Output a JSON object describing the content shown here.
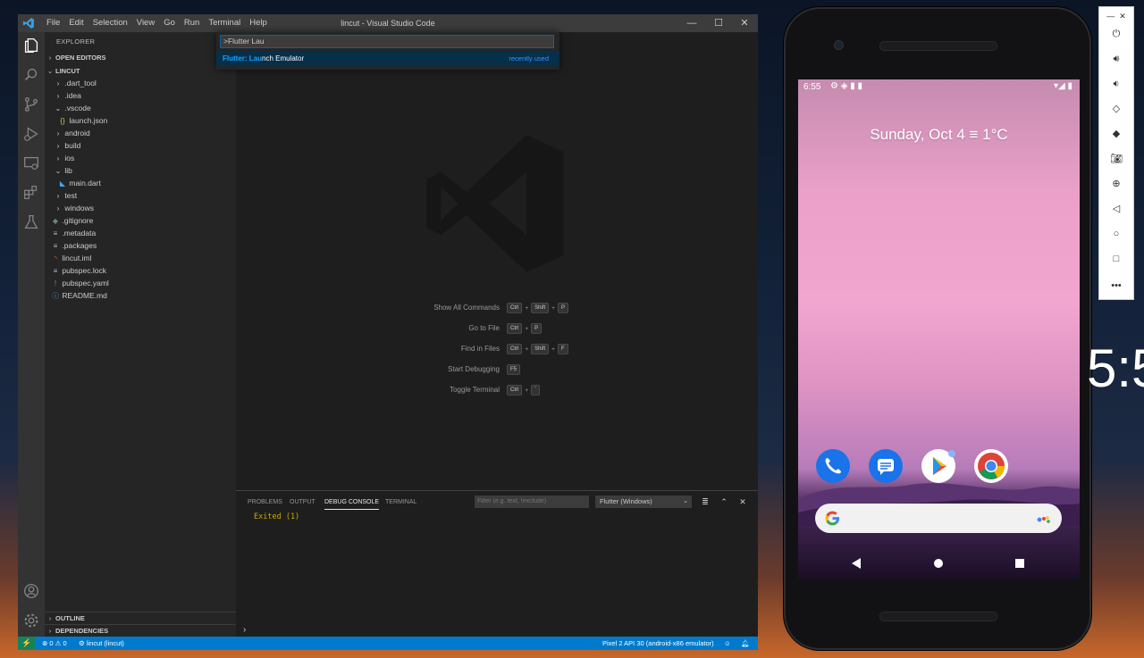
{
  "vscode": {
    "menu": [
      "File",
      "Edit",
      "Selection",
      "View",
      "Go",
      "Run",
      "Terminal",
      "Help"
    ],
    "window_title": "lincut - Visual Studio Code",
    "win_controls": {
      "minimize": "—",
      "maximize": "☐",
      "close": "✕"
    },
    "sidebar": {
      "header": "EXPLORER",
      "open_editors": "OPEN EDITORS",
      "project": "LINCUT",
      "tree": [
        {
          "label": ".dart_tool",
          "icon": "›"
        },
        {
          "label": ".idea",
          "icon": "›"
        },
        {
          "label": ".vscode",
          "icon": "⌄"
        },
        {
          "label": "launch.json",
          "icon": "{}"
        },
        {
          "label": "android",
          "icon": "›"
        },
        {
          "label": "build",
          "icon": "›"
        },
        {
          "label": "ios",
          "icon": "›"
        },
        {
          "label": "lib",
          "icon": "⌄"
        },
        {
          "label": "main.dart",
          "icon": "◣"
        },
        {
          "label": "test",
          "icon": "›"
        },
        {
          "label": "windows",
          "icon": "›"
        },
        {
          "label": ".gitignore",
          "icon": "◆"
        },
        {
          "label": ".metadata",
          "icon": "≡"
        },
        {
          "label": ".packages",
          "icon": "≡"
        },
        {
          "label": "lincut.iml",
          "icon": "◝"
        },
        {
          "label": "pubspec.lock",
          "icon": "≡"
        },
        {
          "label": "pubspec.yaml",
          "icon": "!"
        },
        {
          "label": "README.md",
          "icon": "ⓘ"
        }
      ],
      "outline": "OUTLINE",
      "dependencies": "DEPENDENCIES"
    },
    "quick_open": {
      "input_value": ">Flutter Lau",
      "result_highlight": "Flutter: Lau",
      "result_rest": "nch Emulator",
      "result_hint": "recently used"
    },
    "shortcuts": [
      {
        "label": "Show All Commands",
        "keys": [
          "Ctrl",
          "Shift",
          "P"
        ]
      },
      {
        "label": "Go to File",
        "keys": [
          "Ctrl",
          "P"
        ]
      },
      {
        "label": "Find in Files",
        "keys": [
          "Ctrl",
          "Shift",
          "F"
        ]
      },
      {
        "label": "Start Debugging",
        "keys": [
          "F5"
        ]
      },
      {
        "label": "Toggle Terminal",
        "keys": [
          "Ctrl",
          "`"
        ]
      }
    ],
    "panel": {
      "tabs": [
        "PROBLEMS",
        "OUTPUT",
        "DEBUG CONSOLE",
        "TERMINAL"
      ],
      "filter_placeholder": "Filter (e.g. text, !exclude)",
      "select_value": "Flutter (Windows)",
      "console_output": "Exited (1)",
      "prompt": "›"
    },
    "status": {
      "errors": "0",
      "warnings": "0",
      "branch": "lincut (lincut)",
      "device": "Pixel 2 API 30 (android-x86 emulator)"
    },
    "colors": {
      "accent": "#007acc",
      "remote": "#16825d",
      "highlight": "#18a3ff",
      "warning": "#cca700"
    }
  },
  "emulator": {
    "time": "6:55",
    "date_line": "Sunday, Oct 4 ≡ 1°C",
    "apps": [
      "phone-app",
      "messages-app",
      "play-store-app",
      "chrome-app"
    ],
    "toolbar": [
      "power",
      "volume-up",
      "volume-down",
      "rotate-left",
      "rotate-right",
      "screenshot",
      "zoom",
      "back",
      "home",
      "overview",
      "more"
    ],
    "bg_clock": "5:5"
  }
}
